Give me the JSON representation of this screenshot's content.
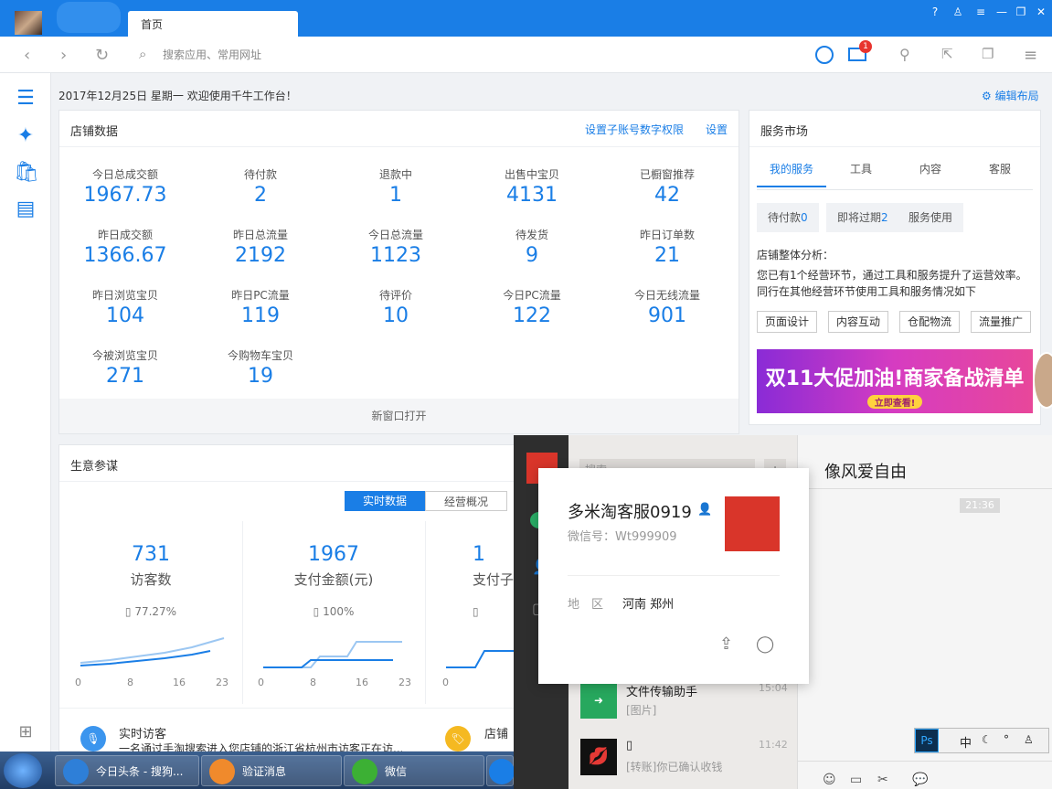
{
  "window": {
    "tab_label": "首页"
  },
  "nav": {
    "search_placeholder": "搜索应用、常用网址",
    "mail_badge": "1"
  },
  "header": {
    "date_text": "2017年12月25日 星期一 欢迎使用千牛工作台！",
    "edit_layout": "编辑布局"
  },
  "store": {
    "title": "店铺数据",
    "link_permissions": "设置子账号数字权限",
    "link_settings": "设置",
    "footer": "新窗口打开",
    "stats": [
      {
        "label": "今日总成交额",
        "value": "1967.73"
      },
      {
        "label": "待付款",
        "value": "2"
      },
      {
        "label": "退款中",
        "value": "1"
      },
      {
        "label": "出售中宝贝",
        "value": "4131"
      },
      {
        "label": "已橱窗推荐",
        "value": "42"
      },
      {
        "label": "昨日成交额",
        "value": "1366.67"
      },
      {
        "label": "昨日总流量",
        "value": "2192"
      },
      {
        "label": "今日总流量",
        "value": "1123"
      },
      {
        "label": "待发货",
        "value": "9"
      },
      {
        "label": "昨日订单数",
        "value": "21"
      },
      {
        "label": "昨日浏览宝贝",
        "value": "104"
      },
      {
        "label": "昨日PC流量",
        "value": "119"
      },
      {
        "label": "待评价",
        "value": "10"
      },
      {
        "label": "今日PC流量",
        "value": "122"
      },
      {
        "label": "今日无线流量",
        "value": "901"
      },
      {
        "label": "今被浏览宝贝",
        "value": "271"
      },
      {
        "label": "今购物车宝贝",
        "value": "19"
      }
    ]
  },
  "service": {
    "title": "服务市场",
    "tabs": [
      "我的服务",
      "工具",
      "内容",
      "客服"
    ],
    "btn_pending": "待付款",
    "btn_pending_count": "0",
    "btn_expiring": "即将过期",
    "btn_expiring_count": "2",
    "btn_usage": "服务使用",
    "analysis_title": "店铺整体分析：",
    "analysis_text": "您已有1个经营环节，通过工具和服务提升了运营效率。同行在其他经营环节使用工具和服务情况如下",
    "tags": [
      "页面设计",
      "内容互动",
      "仓配物流",
      "流量推广"
    ],
    "banner_text": "双11大促加油!商家备战清单",
    "banner_cta": "立即查看!"
  },
  "business": {
    "title": "生意参谋",
    "seg_realtime": "实时数据",
    "seg_overview": "经营概况",
    "metrics": [
      {
        "value": "731",
        "label": "访客数",
        "pct": "77.27%"
      },
      {
        "value": "1967",
        "label": "支付金额(元)",
        "pct": "100%"
      },
      {
        "value": "1",
        "label": "支付子",
        "pct": ""
      }
    ],
    "axis_ticks": [
      "0",
      "8",
      "16",
      "23"
    ],
    "visitor_title": "实时访客",
    "visitor_text": "一名通过手淘搜索进入您店铺的浙江省杭州市访客正在访...",
    "shop_title": "店铺"
  },
  "taskbar": {
    "items": [
      "今日头条 - 搜狗...",
      "验证消息",
      "微信"
    ]
  },
  "wechat": {
    "search_placeholder": "搜索",
    "chat_title": "像风爱自由",
    "chat_time": "21:36",
    "popup_name": "多米淘客服0919",
    "popup_wxid": "微信号：Wt999909",
    "popup_region_label": "地　区",
    "popup_region": "河南 郑州",
    "list": [
      {
        "name": "文件传输助手",
        "msg": "[图片]",
        "time": "15:04"
      },
      {
        "name": "▯",
        "msg": "[转账]你已确认收钱",
        "time": "11:42"
      }
    ]
  },
  "tray": {
    "ime": "中"
  }
}
